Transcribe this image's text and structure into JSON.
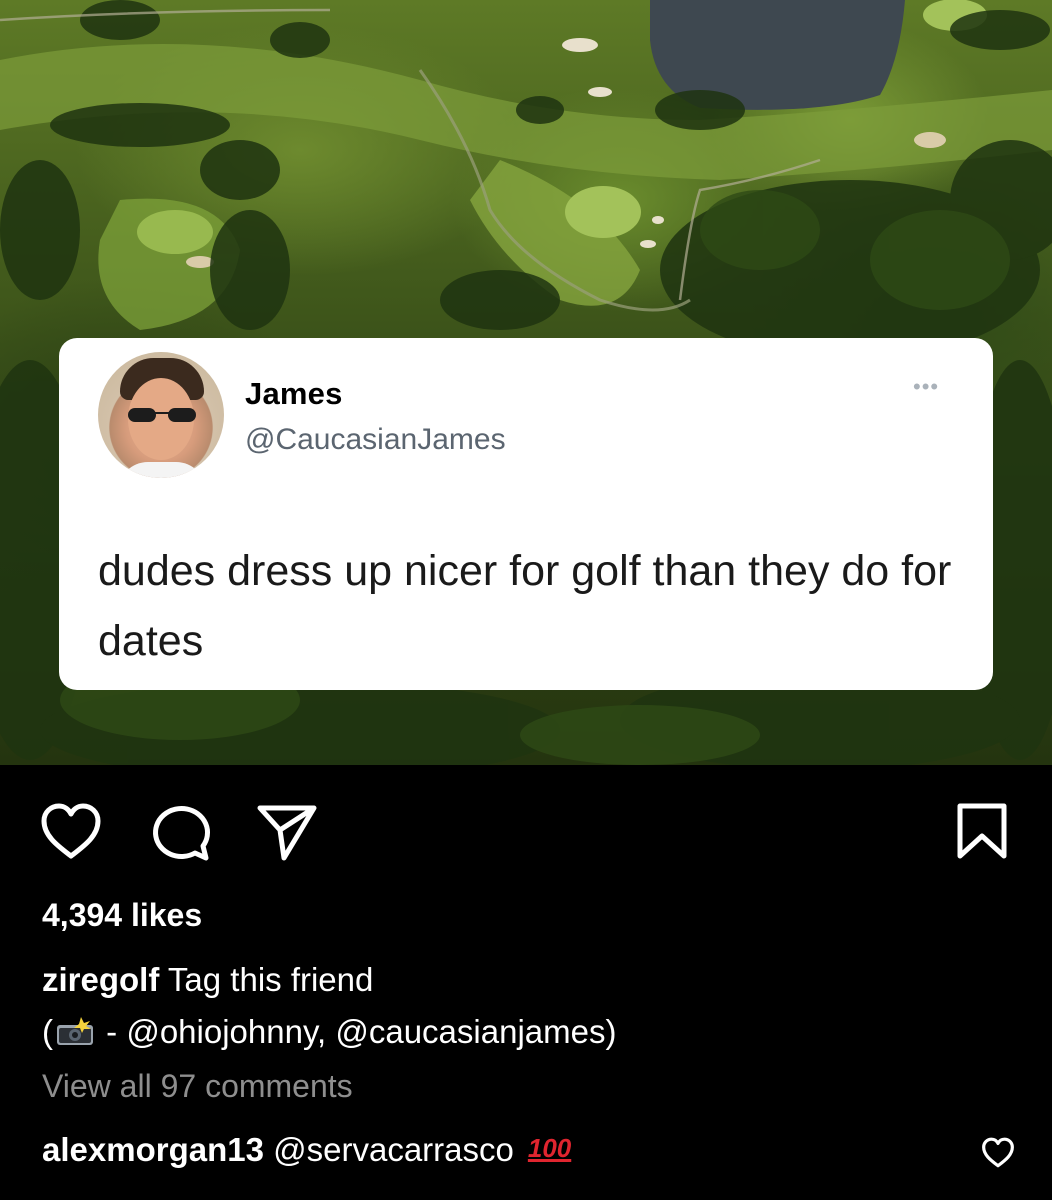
{
  "post": {
    "image_alt": "golf-course-aerial",
    "tweet": {
      "name": "James",
      "handle": "@CaucasianJames",
      "more": "•••",
      "text": "dudes dress up nicer for golf than they do for dates"
    }
  },
  "actions": {
    "like_icon": "heart-icon",
    "comment_icon": "comment-icon",
    "share_icon": "send-icon",
    "save_icon": "bookmark-icon"
  },
  "likes": "4,394 likes",
  "caption": {
    "username": "ziregolf",
    "text": "Tag this friend",
    "line2_prefix": "(",
    "camera_emoji": "📸",
    "line2_text": " - @ohiojohnny, @caucasianjames)"
  },
  "view_comments": "View all 97 comments",
  "comment": {
    "username": "alexmorgan13",
    "text": "@servacarrasco",
    "emoji": "100"
  },
  "colors": {
    "background": "#000000",
    "text": "#ffffff",
    "muted": "#8e8e8e",
    "card": "#ffffff",
    "handle": "#5b6570"
  }
}
